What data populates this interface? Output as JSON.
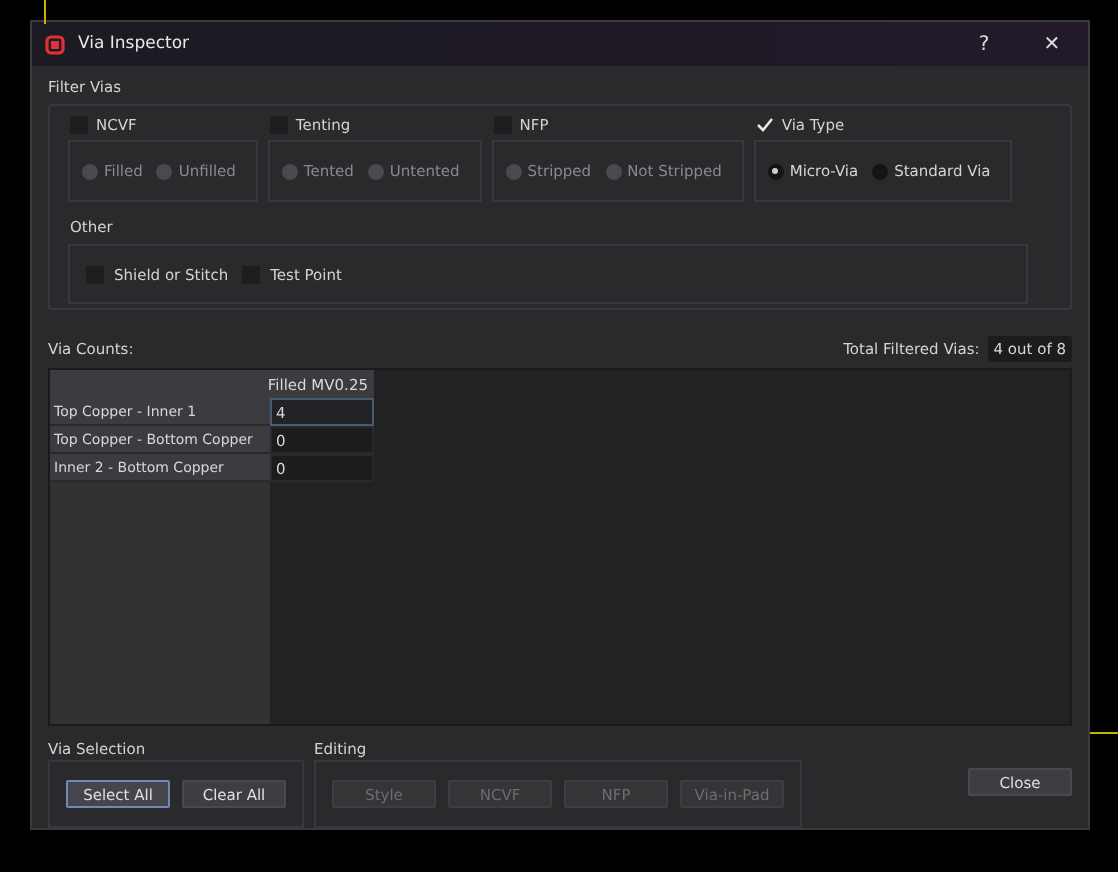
{
  "window": {
    "title": "Via Inspector",
    "help": "?",
    "close": "✕"
  },
  "filter_vias": {
    "title": "Filter Vias",
    "groups": [
      {
        "label": "NCVF",
        "checked": false,
        "options": [
          {
            "label": "Filled",
            "selected": false
          },
          {
            "label": "Unfilled",
            "selected": false
          }
        ]
      },
      {
        "label": "Tenting",
        "checked": false,
        "options": [
          {
            "label": "Tented",
            "selected": false
          },
          {
            "label": "Untented",
            "selected": false
          }
        ]
      },
      {
        "label": "NFP",
        "checked": false,
        "options": [
          {
            "label": "Stripped",
            "selected": false
          },
          {
            "label": "Not Stripped",
            "selected": false
          }
        ]
      },
      {
        "label": "Via Type",
        "checked": true,
        "options": [
          {
            "label": "Micro-Via",
            "selected": true
          },
          {
            "label": "Standard Via",
            "selected": false
          }
        ]
      }
    ],
    "other": {
      "title": "Other",
      "options": [
        {
          "label": "Shield or Stitch",
          "checked": false
        },
        {
          "label": "Test Point",
          "checked": false
        }
      ]
    }
  },
  "via_counts": {
    "title": "Via Counts:",
    "total_label": "Total Filtered Vias:",
    "total_value": "4 out of 8"
  },
  "table": {
    "columns": [
      "Filled MV0.25"
    ],
    "rows": [
      {
        "label": "Top Copper - Inner 1",
        "value": "4",
        "selected": true
      },
      {
        "label": "Top Copper - Bottom Copper",
        "value": "0",
        "selected": false
      },
      {
        "label": "Inner 2 - Bottom Copper",
        "value": "0",
        "selected": false
      }
    ]
  },
  "via_selection": {
    "title": "Via Selection",
    "buttons": [
      {
        "label": "Select All",
        "selected": true
      },
      {
        "label": "Clear All",
        "selected": false
      }
    ]
  },
  "editing": {
    "title": "Editing",
    "buttons": [
      {
        "label": "Style",
        "disabled": true
      },
      {
        "label": "NCVF",
        "disabled": true
      },
      {
        "label": "NFP",
        "disabled": true
      },
      {
        "label": "Via-in-Pad",
        "disabled": true
      }
    ]
  },
  "close_button": "Close"
}
